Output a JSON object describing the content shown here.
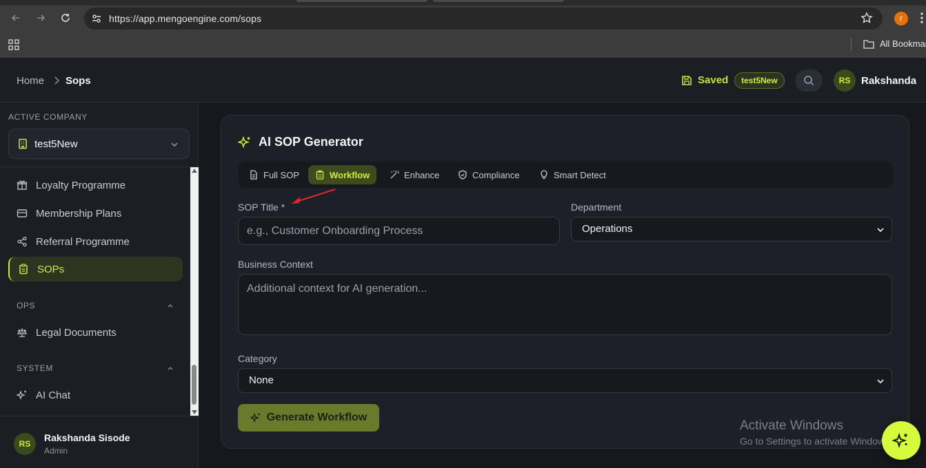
{
  "browser": {
    "url": "https://app.mengoengine.com/sops",
    "profile_initial": "r",
    "bookmarks_label": "All Bookmarks"
  },
  "header": {
    "breadcrumb_home": "Home",
    "breadcrumb_current": "Sops",
    "saved_label": "Saved",
    "company_badge": "test5New",
    "user_initials": "RS",
    "user_name": "Rakshanda"
  },
  "sidebar": {
    "active_company_label": "ACTIVE COMPANY",
    "company_name": "test5New",
    "items": [
      {
        "label": "Loyalty Programme",
        "icon": "gift-icon"
      },
      {
        "label": "Membership Plans",
        "icon": "card-icon"
      },
      {
        "label": "Referral Programme",
        "icon": "share-icon"
      },
      {
        "label": "SOPs",
        "icon": "clipboard-icon",
        "active": true
      }
    ],
    "ops_label": "OPS",
    "ops_items": [
      {
        "label": "Legal Documents",
        "icon": "scale-icon"
      }
    ],
    "system_label": "SYSTEM",
    "system_items": [
      {
        "label": "AI Chat",
        "icon": "sparkles-icon"
      }
    ],
    "footer": {
      "initials": "RS",
      "name": "Rakshanda Sisode",
      "role": "Admin"
    }
  },
  "main": {
    "title": "AI SOP Generator",
    "tabs": [
      {
        "label": "Full SOP",
        "icon": "file-icon"
      },
      {
        "label": "Workflow",
        "icon": "clipboard-icon",
        "active": true
      },
      {
        "label": "Enhance",
        "icon": "wand-icon"
      },
      {
        "label": "Compliance",
        "icon": "shield-icon"
      },
      {
        "label": "Smart Detect",
        "icon": "bulb-icon"
      }
    ],
    "sop_title_label": "SOP Title *",
    "sop_title_placeholder": "e.g., Customer Onboarding Process",
    "department_label": "Department",
    "department_value": "Operations",
    "business_context_label": "Business Context",
    "business_context_placeholder": "Additional context for AI generation...",
    "category_label": "Category",
    "category_value": "None",
    "generate_button": "Generate Workflow"
  },
  "watermark": {
    "title": "Activate Windows",
    "subtitle": "Go to Settings to activate Windows."
  },
  "colors": {
    "accent": "#c9ef3a",
    "background": "#16181d",
    "annotation_arrow": "#e0282e"
  }
}
